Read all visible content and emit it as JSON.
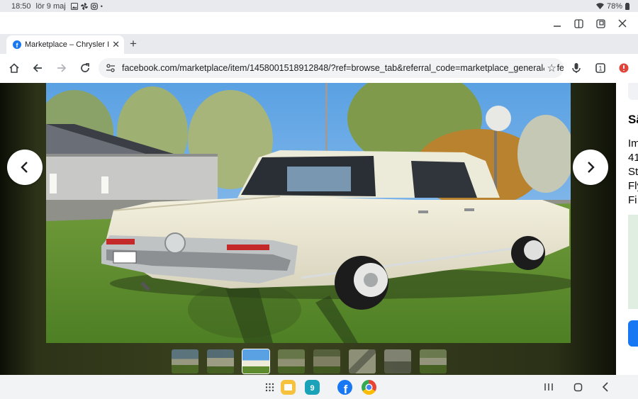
{
  "status_bar": {
    "time": "18:50",
    "date": "lör 9 maj",
    "battery": "78%"
  },
  "tab": {
    "title": "Marketplace – Chrysler Imp"
  },
  "toolbar": {
    "url": "facebook.com/marketplace/item/1458001518912848/?ref=browse_tab&referral_code=marketplace_general&referral_"
  },
  "side_panel": {
    "title_fragment": "Sä",
    "lines": [
      "Im",
      "41",
      "St",
      "Fly",
      "Fi"
    ]
  },
  "gallery": {
    "thumbnail_count": 8,
    "active_index": 2
  },
  "colors": {
    "facebook_blue": "#1877f2",
    "chrome_surface": "#f1f3f4"
  }
}
